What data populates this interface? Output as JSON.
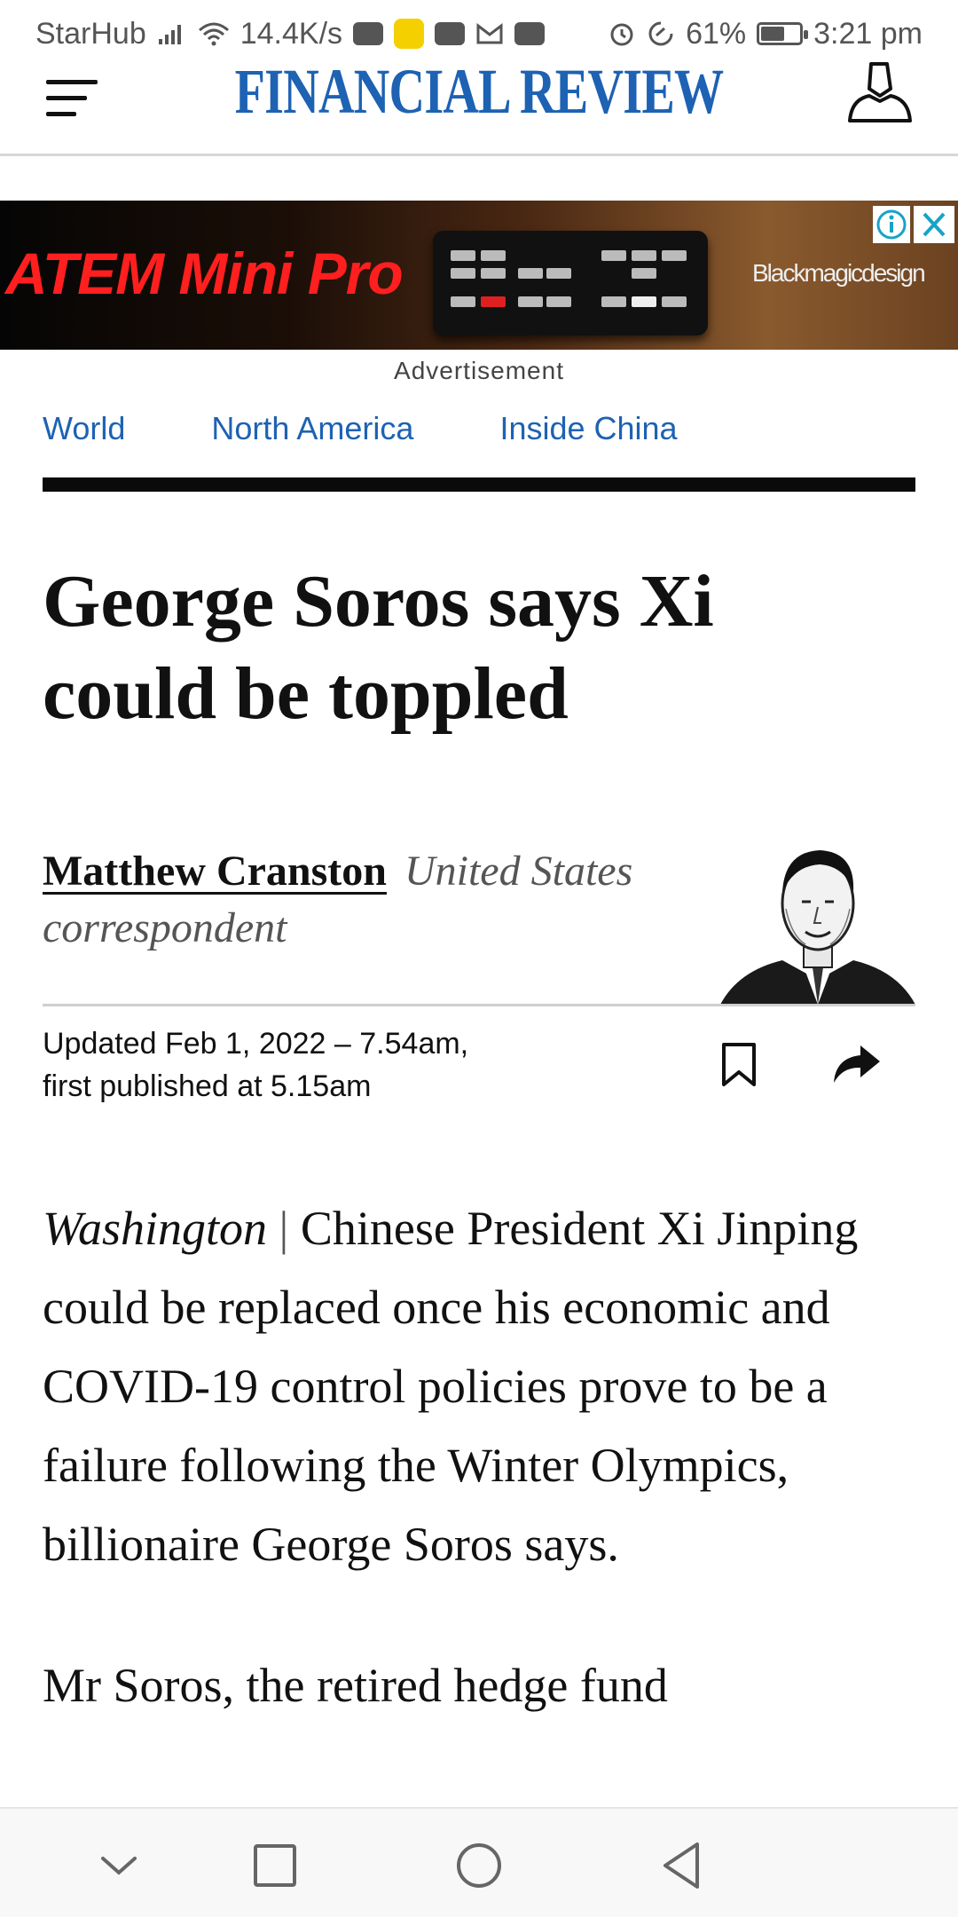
{
  "status_bar": {
    "carrier": "StarHub",
    "speed": "14.4K/s",
    "battery_percent": "61%",
    "battery_level": 0.61,
    "time": "3:21 pm",
    "icons": [
      "signal-icon",
      "wifi-icon",
      "youtube-icon",
      "smiley-icon",
      "youtube-icon",
      "gmail-icon",
      "youtube-icon",
      "alarm-icon",
      "data-saver-icon",
      "battery-icon"
    ]
  },
  "header": {
    "brand": "FINANCIAL REVIEW",
    "brand_color": "#1d62b3",
    "menu_icon": "hamburger-icon",
    "account_icon": "user-icon"
  },
  "ad": {
    "headline": "ATEM Mini Pro",
    "brand": "Blackmagicdesign",
    "label": "Advertisement",
    "info_icon": "info-icon",
    "close_icon": "close-icon"
  },
  "sections": [
    {
      "label": "World"
    },
    {
      "label": "North America"
    },
    {
      "label": "Inside China"
    }
  ],
  "article": {
    "headline_line1": "George Soros says Xi",
    "headline_line2": "could be toppled",
    "author": "Matthew Cranston",
    "author_role": "United States correspondent",
    "updated": "Updated Feb 1, 2022 – 7.54am,",
    "first_published": "first published at 5.15am",
    "dateline": "Washington",
    "separator": "|",
    "paragraph1": "Chinese President Xi Jinping could be replaced once his economic and COVID-19 control policies prove to be a failure following the Winter Olympics, billionaire George Soros says.",
    "paragraph2": "Mr Soros, the retired hedge fund"
  },
  "nav": {
    "icons": [
      "collapse-icon",
      "recents-icon",
      "home-icon",
      "back-icon"
    ]
  }
}
